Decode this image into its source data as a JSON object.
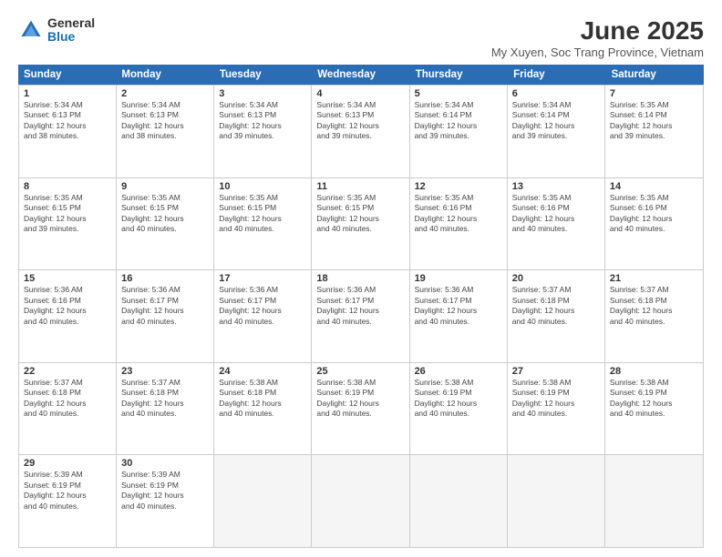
{
  "logo": {
    "general": "General",
    "blue": "Blue"
  },
  "header": {
    "month": "June 2025",
    "location": "My Xuyen, Soc Trang Province, Vietnam"
  },
  "weekdays": [
    "Sunday",
    "Monday",
    "Tuesday",
    "Wednesday",
    "Thursday",
    "Friday",
    "Saturday"
  ],
  "rows": [
    [
      {
        "day": "1",
        "info": "Sunrise: 5:34 AM\nSunset: 6:13 PM\nDaylight: 12 hours\nand 38 minutes."
      },
      {
        "day": "2",
        "info": "Sunrise: 5:34 AM\nSunset: 6:13 PM\nDaylight: 12 hours\nand 38 minutes."
      },
      {
        "day": "3",
        "info": "Sunrise: 5:34 AM\nSunset: 6:13 PM\nDaylight: 12 hours\nand 39 minutes."
      },
      {
        "day": "4",
        "info": "Sunrise: 5:34 AM\nSunset: 6:13 PM\nDaylight: 12 hours\nand 39 minutes."
      },
      {
        "day": "5",
        "info": "Sunrise: 5:34 AM\nSunset: 6:14 PM\nDaylight: 12 hours\nand 39 minutes."
      },
      {
        "day": "6",
        "info": "Sunrise: 5:34 AM\nSunset: 6:14 PM\nDaylight: 12 hours\nand 39 minutes."
      },
      {
        "day": "7",
        "info": "Sunrise: 5:35 AM\nSunset: 6:14 PM\nDaylight: 12 hours\nand 39 minutes."
      }
    ],
    [
      {
        "day": "8",
        "info": "Sunrise: 5:35 AM\nSunset: 6:15 PM\nDaylight: 12 hours\nand 39 minutes."
      },
      {
        "day": "9",
        "info": "Sunrise: 5:35 AM\nSunset: 6:15 PM\nDaylight: 12 hours\nand 40 minutes."
      },
      {
        "day": "10",
        "info": "Sunrise: 5:35 AM\nSunset: 6:15 PM\nDaylight: 12 hours\nand 40 minutes."
      },
      {
        "day": "11",
        "info": "Sunrise: 5:35 AM\nSunset: 6:15 PM\nDaylight: 12 hours\nand 40 minutes."
      },
      {
        "day": "12",
        "info": "Sunrise: 5:35 AM\nSunset: 6:16 PM\nDaylight: 12 hours\nand 40 minutes."
      },
      {
        "day": "13",
        "info": "Sunrise: 5:35 AM\nSunset: 6:16 PM\nDaylight: 12 hours\nand 40 minutes."
      },
      {
        "day": "14",
        "info": "Sunrise: 5:35 AM\nSunset: 6:16 PM\nDaylight: 12 hours\nand 40 minutes."
      }
    ],
    [
      {
        "day": "15",
        "info": "Sunrise: 5:36 AM\nSunset: 6:16 PM\nDaylight: 12 hours\nand 40 minutes."
      },
      {
        "day": "16",
        "info": "Sunrise: 5:36 AM\nSunset: 6:17 PM\nDaylight: 12 hours\nand 40 minutes."
      },
      {
        "day": "17",
        "info": "Sunrise: 5:36 AM\nSunset: 6:17 PM\nDaylight: 12 hours\nand 40 minutes."
      },
      {
        "day": "18",
        "info": "Sunrise: 5:36 AM\nSunset: 6:17 PM\nDaylight: 12 hours\nand 40 minutes."
      },
      {
        "day": "19",
        "info": "Sunrise: 5:36 AM\nSunset: 6:17 PM\nDaylight: 12 hours\nand 40 minutes."
      },
      {
        "day": "20",
        "info": "Sunrise: 5:37 AM\nSunset: 6:18 PM\nDaylight: 12 hours\nand 40 minutes."
      },
      {
        "day": "21",
        "info": "Sunrise: 5:37 AM\nSunset: 6:18 PM\nDaylight: 12 hours\nand 40 minutes."
      }
    ],
    [
      {
        "day": "22",
        "info": "Sunrise: 5:37 AM\nSunset: 6:18 PM\nDaylight: 12 hours\nand 40 minutes."
      },
      {
        "day": "23",
        "info": "Sunrise: 5:37 AM\nSunset: 6:18 PM\nDaylight: 12 hours\nand 40 minutes."
      },
      {
        "day": "24",
        "info": "Sunrise: 5:38 AM\nSunset: 6:18 PM\nDaylight: 12 hours\nand 40 minutes."
      },
      {
        "day": "25",
        "info": "Sunrise: 5:38 AM\nSunset: 6:19 PM\nDaylight: 12 hours\nand 40 minutes."
      },
      {
        "day": "26",
        "info": "Sunrise: 5:38 AM\nSunset: 6:19 PM\nDaylight: 12 hours\nand 40 minutes."
      },
      {
        "day": "27",
        "info": "Sunrise: 5:38 AM\nSunset: 6:19 PM\nDaylight: 12 hours\nand 40 minutes."
      },
      {
        "day": "28",
        "info": "Sunrise: 5:38 AM\nSunset: 6:19 PM\nDaylight: 12 hours\nand 40 minutes."
      }
    ],
    [
      {
        "day": "29",
        "info": "Sunrise: 5:39 AM\nSunset: 6:19 PM\nDaylight: 12 hours\nand 40 minutes."
      },
      {
        "day": "30",
        "info": "Sunrise: 5:39 AM\nSunset: 6:19 PM\nDaylight: 12 hours\nand 40 minutes."
      },
      {
        "day": "",
        "info": ""
      },
      {
        "day": "",
        "info": ""
      },
      {
        "day": "",
        "info": ""
      },
      {
        "day": "",
        "info": ""
      },
      {
        "day": "",
        "info": ""
      }
    ]
  ]
}
